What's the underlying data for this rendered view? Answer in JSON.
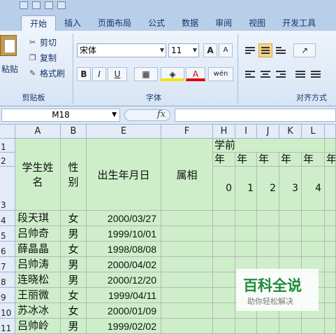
{
  "ribbon": {
    "tabs": [
      "开始",
      "插入",
      "页面布局",
      "公式",
      "数据",
      "审阅",
      "视图",
      "开发工具"
    ],
    "active_tab": "开始",
    "clipboard": {
      "paste_label": "粘贴",
      "cut_label": "剪切",
      "copy_label": "复制",
      "format_painter_label": "格式刷",
      "group_label": "剪贴板"
    },
    "font": {
      "font_name": "宋体",
      "font_size": "11",
      "grow_label": "A",
      "shrink_label": "A",
      "bold_label": "B",
      "italic_label": "I",
      "underline_label": "U",
      "font_color_label": "A",
      "phonetic_label": "wén",
      "group_label": "字体"
    },
    "alignment": {
      "group_label": "对齐方式"
    }
  },
  "formula_bar": {
    "name_box": "M18",
    "fx_label": "fx",
    "formula": ""
  },
  "sheet": {
    "column_headers": [
      "A",
      "B",
      "E",
      "F",
      "H",
      "I",
      "J",
      "K",
      "L"
    ],
    "row_headers": [
      "1",
      "2",
      "3",
      "4",
      "5",
      "6",
      "7",
      "8",
      "9",
      "10",
      "11"
    ],
    "headers": {
      "name": "学生姓名",
      "gender": "性别",
      "birth": "出生年月日",
      "zodiac": "属相",
      "before_school": "学前",
      "year": "年",
      "year_numbers": [
        "0",
        "1",
        "2",
        "3",
        "4"
      ]
    },
    "rows": [
      {
        "name": "段天琪",
        "gender": "女",
        "birth": "2000/03/27"
      },
      {
        "name": "吕帅奇",
        "gender": "男",
        "birth": "1999/10/01"
      },
      {
        "name": "薛晶晶",
        "gender": "女",
        "birth": "1998/08/08"
      },
      {
        "name": "吕帅涛",
        "gender": "男",
        "birth": "2000/04/02"
      },
      {
        "name": "连晓松",
        "gender": "男",
        "birth": "2000/12/20"
      },
      {
        "name": "王丽微",
        "gender": "女",
        "birth": "1999/04/11"
      },
      {
        "name": "苏冰冰",
        "gender": "女",
        "birth": "2000/01/09"
      },
      {
        "name": "吕帅岭",
        "gender": "男",
        "birth": "1999/02/02"
      }
    ]
  },
  "watermark": {
    "title": "百科全说",
    "subtitle": "助你轻松解决"
  },
  "colors": {
    "ribbon_bg": "#b9cfe9",
    "cell_green": "#cdeec9"
  }
}
